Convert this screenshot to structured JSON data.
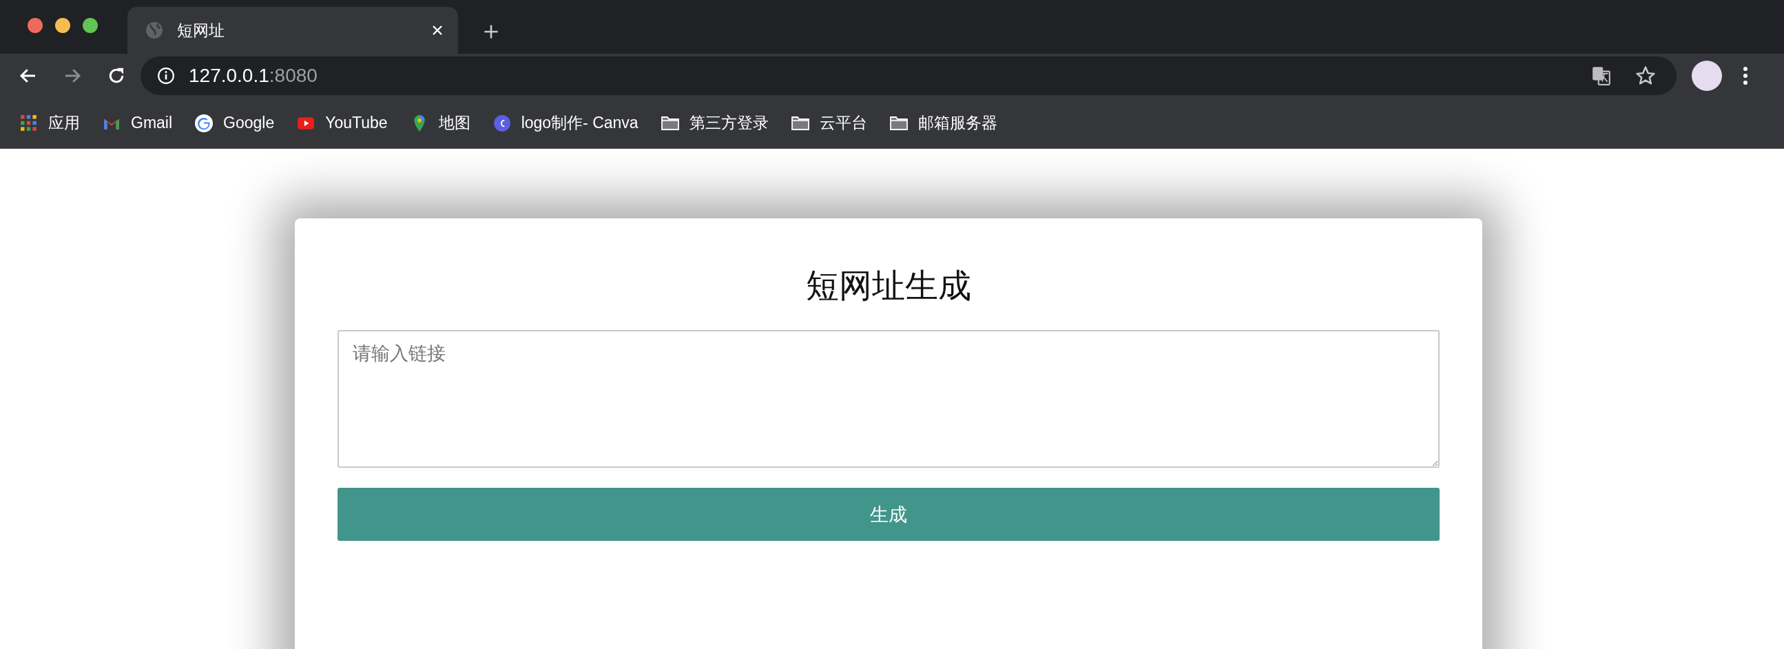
{
  "browser": {
    "tab": {
      "title": "短网址"
    },
    "url": {
      "host": "127.0.0.1",
      "port": ":8080"
    },
    "bookmarks": [
      {
        "label": "应用",
        "kind": "apps"
      },
      {
        "label": "Gmail",
        "kind": "gmail"
      },
      {
        "label": "Google",
        "kind": "google"
      },
      {
        "label": "YouTube",
        "kind": "youtube"
      },
      {
        "label": "地图",
        "kind": "maps"
      },
      {
        "label": "logo制作- Canva",
        "kind": "canva"
      },
      {
        "label": "第三方登录",
        "kind": "folder"
      },
      {
        "label": "云平台",
        "kind": "folder"
      },
      {
        "label": "邮箱服务器",
        "kind": "folder"
      }
    ]
  },
  "page": {
    "title": "短网址生成",
    "input": {
      "placeholder": "请输入链接"
    },
    "button": "生成"
  }
}
